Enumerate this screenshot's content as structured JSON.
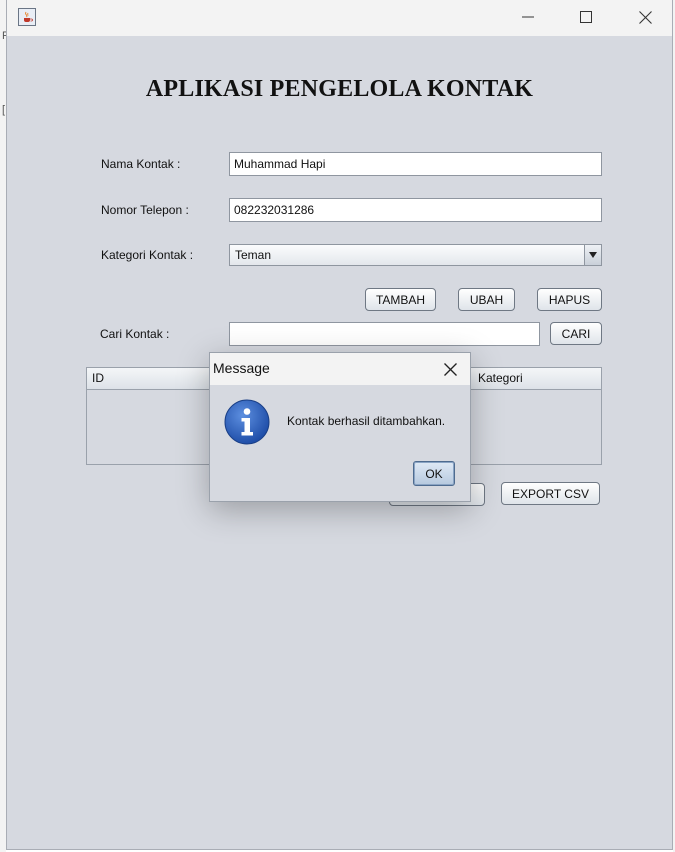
{
  "window": {
    "app_title": "APLIKASI PENGELOLA KONTAK"
  },
  "form": {
    "nama_label": "Nama Kontak :",
    "nama_value": "Muhammad Hapi",
    "telepon_label": "Nomor Telepon :",
    "telepon_value": "082232031286",
    "kategori_label": "Kategori Kontak :",
    "kategori_value": "Teman",
    "cari_label": "Cari Kontak :",
    "cari_value": ""
  },
  "buttons": {
    "tambah": "TAMBAH",
    "ubah": "UBAH",
    "hapus": "HAPUS",
    "cari": "CARI",
    "export_csv": "EXPORT CSV"
  },
  "table": {
    "columns": [
      "ID",
      "Kategori"
    ]
  },
  "dialog": {
    "title": "Message",
    "message": "Kontak berhasil ditambahkan.",
    "ok": "OK"
  },
  "background": {
    "fragment_1": "F",
    "fragment_2": "["
  },
  "icons": {
    "app": "java-icon",
    "minimize": "minimize-icon",
    "maximize": "maximize-icon",
    "close": "close-icon",
    "dropdown": "chevron-down-icon",
    "info": "info-icon"
  },
  "colors": {
    "window_bg": "#d6d9e0",
    "titlebar_bg": "#f3f3f3",
    "info_blue": "#2a5cb8"
  }
}
